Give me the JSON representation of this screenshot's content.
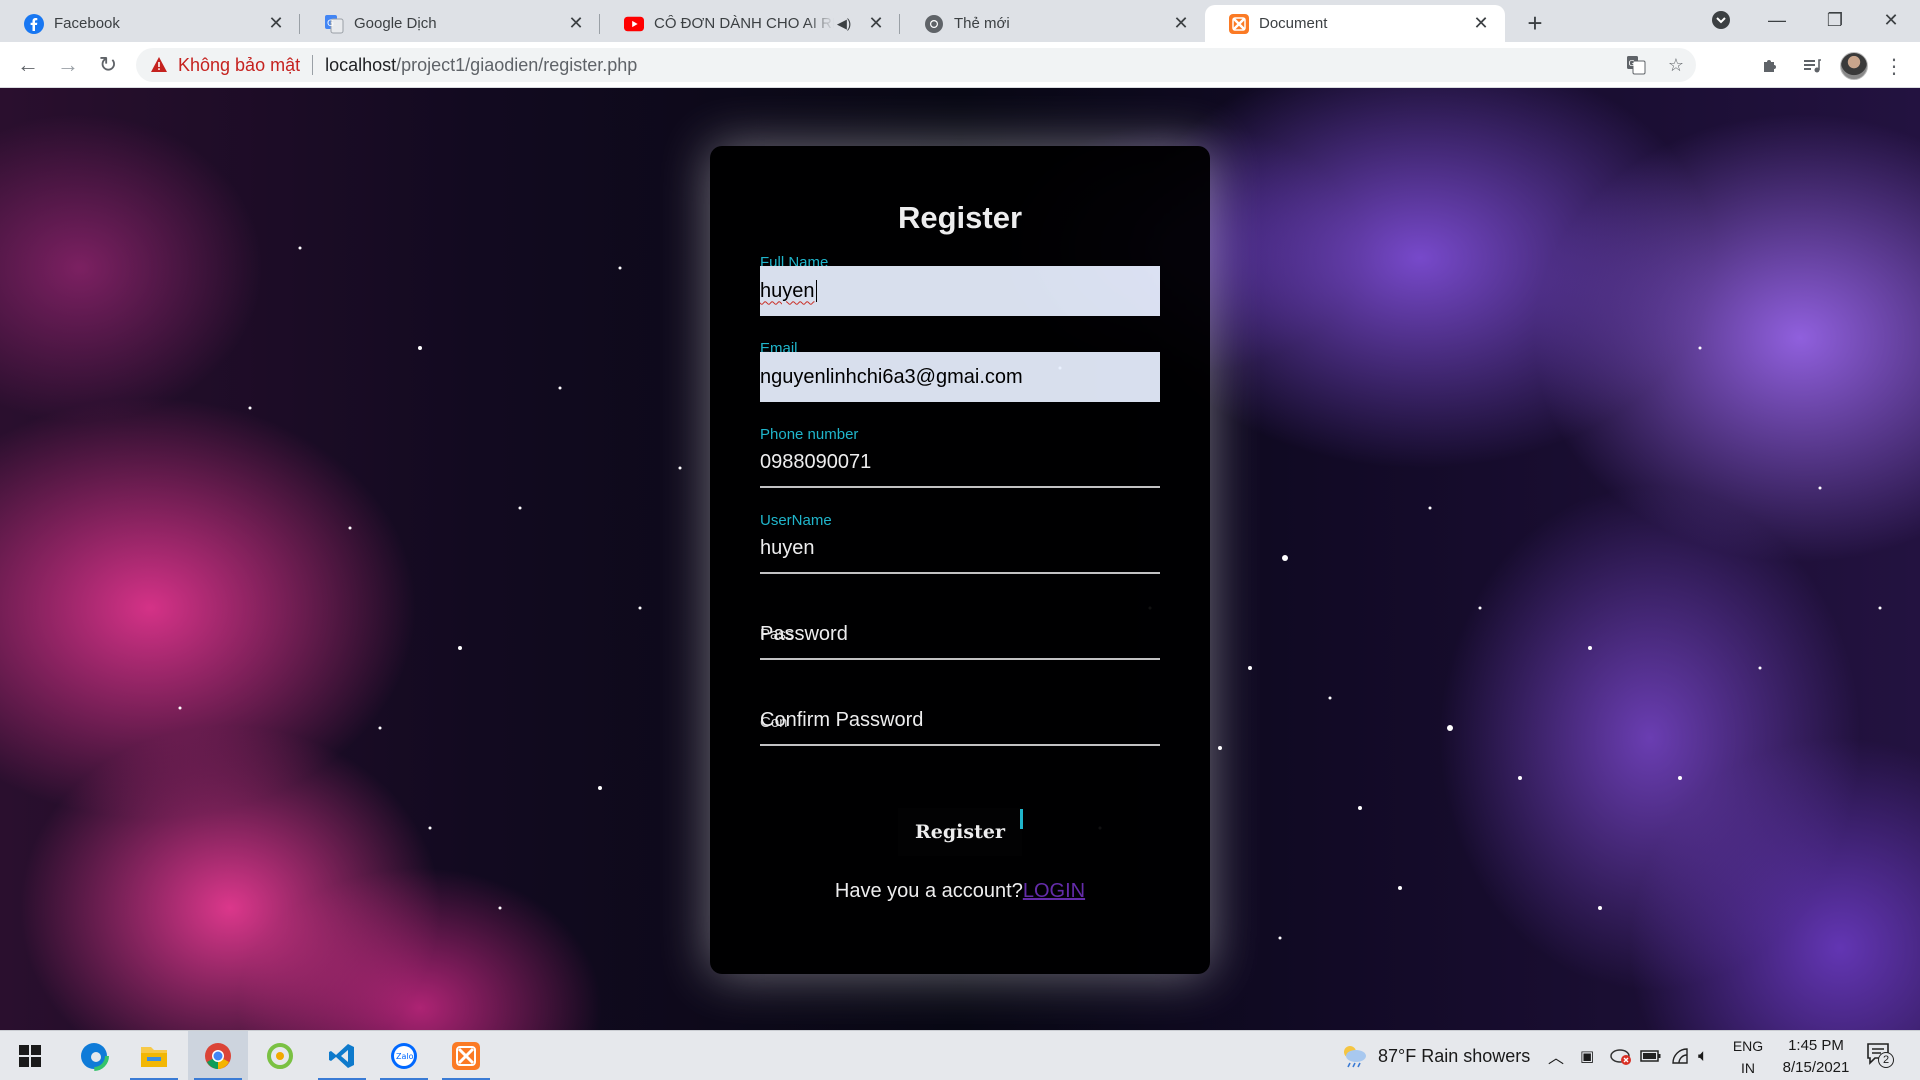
{
  "browser": {
    "tabs": [
      {
        "title": "Facebook",
        "icon": "facebook-icon"
      },
      {
        "title": "Google Dịch",
        "icon": "google-translate-icon"
      },
      {
        "title": "CÔ ĐƠN DÀNH CHO AI REM",
        "icon": "youtube-icon"
      },
      {
        "title": "Thẻ mới",
        "icon": "chrome-icon"
      },
      {
        "title": "Document",
        "icon": "xampp-icon"
      }
    ],
    "address": {
      "security_label": "Không bảo mật",
      "host": "localhost",
      "path": "/project1/giaodien/register.php"
    }
  },
  "form": {
    "title": "Register",
    "fields": [
      {
        "label": "Full Name",
        "value": "huyen"
      },
      {
        "label": "Email",
        "value": "nguyenlinhchi6a3@gmai.com"
      },
      {
        "label": "Phone number",
        "value": "0988090071"
      },
      {
        "label": "UserName",
        "value": "huyen"
      },
      {
        "label": "Password",
        "overlap_label": "Pass"
      },
      {
        "label": "Confirm Password",
        "overlap_label": "Con"
      }
    ],
    "submit_label": "Register",
    "footer_text": "Have you a account?",
    "login_link": "LOGIN"
  },
  "taskbar": {
    "weather": "87°F  Rain showers",
    "language": "ENG",
    "language_sub": "IN",
    "time": "1:45 PM",
    "date": "8/15/2021",
    "notification_count": "2"
  },
  "colors": {
    "label_accent": "#22c3d9",
    "login_link": "#6b2fb5",
    "autofill_bg": "#e8f0fe"
  }
}
